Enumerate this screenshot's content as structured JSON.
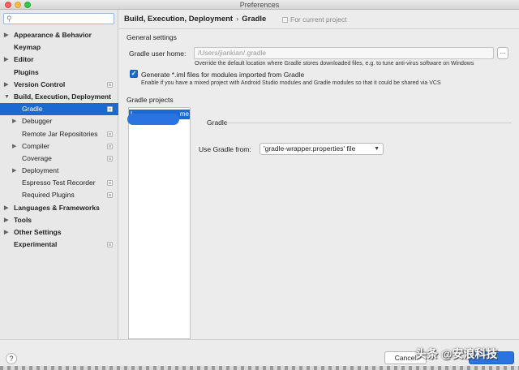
{
  "window": {
    "title": "Preferences"
  },
  "search": {
    "placeholder": "",
    "value": ""
  },
  "sidebar": {
    "items": [
      {
        "label": "Appearance & Behavior",
        "bold": true,
        "level": 0,
        "arrow": "▶",
        "project_icon": false,
        "selected": false
      },
      {
        "label": "Keymap",
        "bold": true,
        "level": 0,
        "arrow": "",
        "project_icon": false,
        "selected": false
      },
      {
        "label": "Editor",
        "bold": true,
        "level": 0,
        "arrow": "▶",
        "project_icon": false,
        "selected": false
      },
      {
        "label": "Plugins",
        "bold": true,
        "level": 0,
        "arrow": "",
        "project_icon": false,
        "selected": false
      },
      {
        "label": "Version Control",
        "bold": true,
        "level": 0,
        "arrow": "▶",
        "project_icon": true,
        "selected": false
      },
      {
        "label": "Build, Execution, Deployment",
        "bold": true,
        "level": 0,
        "arrow": "▼",
        "project_icon": false,
        "selected": false
      },
      {
        "label": "Gradle",
        "bold": false,
        "level": 1,
        "arrow": "",
        "project_icon": true,
        "selected": true
      },
      {
        "label": "Debugger",
        "bold": false,
        "level": 1,
        "arrow": "▶",
        "project_icon": false,
        "selected": false
      },
      {
        "label": "Remote Jar Repositories",
        "bold": false,
        "level": 1,
        "arrow": "",
        "project_icon": true,
        "selected": false
      },
      {
        "label": "Compiler",
        "bold": false,
        "level": 1,
        "arrow": "▶",
        "project_icon": true,
        "selected": false
      },
      {
        "label": "Coverage",
        "bold": false,
        "level": 1,
        "arrow": "",
        "project_icon": true,
        "selected": false
      },
      {
        "label": "Deployment",
        "bold": false,
        "level": 1,
        "arrow": "▶",
        "project_icon": false,
        "selected": false
      },
      {
        "label": "Espresso Test Recorder",
        "bold": false,
        "level": 1,
        "arrow": "",
        "project_icon": true,
        "selected": false
      },
      {
        "label": "Required Plugins",
        "bold": false,
        "level": 1,
        "arrow": "",
        "project_icon": true,
        "selected": false
      },
      {
        "label": "Languages & Frameworks",
        "bold": true,
        "level": 0,
        "arrow": "▶",
        "project_icon": false,
        "selected": false
      },
      {
        "label": "Tools",
        "bold": true,
        "level": 0,
        "arrow": "▶",
        "project_icon": false,
        "selected": false
      },
      {
        "label": "Other Settings",
        "bold": true,
        "level": 0,
        "arrow": "▶",
        "project_icon": false,
        "selected": false
      },
      {
        "label": "Experimental",
        "bold": true,
        "level": 0,
        "arrow": "",
        "project_icon": true,
        "selected": false
      }
    ]
  },
  "header": {
    "breadcrumb_parent": "Build, Execution, Deployment",
    "breadcrumb_separator": "›",
    "breadcrumb_current": "Gradle",
    "for_current_project": "For current project"
  },
  "general": {
    "section_title": "General settings",
    "gradle_home_label": "Gradle user home:",
    "gradle_home_value": "/Users/jiankian/.gradle",
    "browse_label": "...",
    "gradle_home_hint": "Override the default location where Gradle stores downloaded files, e.g. to tune anti-virus software on Windows",
    "generate_iml_checked": true,
    "generate_iml_label": "Generate *.iml files for modules imported from Gradle",
    "generate_iml_hint": "Enable if you have a mixed project with Android Studio modules and Gradle modules so that it could be shared via VCS"
  },
  "projects": {
    "section_title": "Gradle projects",
    "list_item_left": "L",
    "list_item_right": "me"
  },
  "gradle": {
    "section_title": "Gradle",
    "use_gradle_from_label": "Use Gradle from:",
    "use_gradle_from_value": "'gradle-wrapper.properties' file"
  },
  "footer": {
    "help_label": "?",
    "cancel_label": "Cancel"
  },
  "watermark": "头条 @安浪科技",
  "colors": {
    "accent": "#1b6ad1",
    "ok_button": "#2b74e0"
  }
}
